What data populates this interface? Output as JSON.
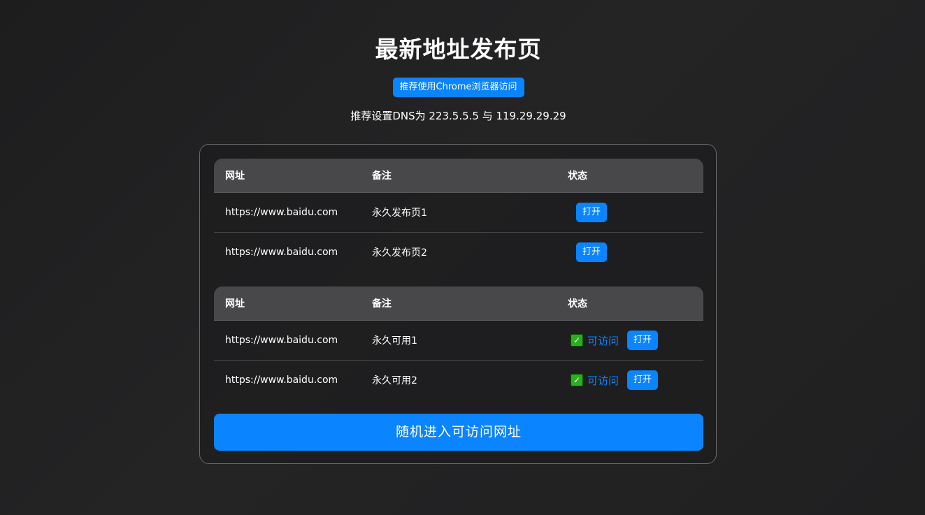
{
  "page": {
    "title": "最新地址发布页",
    "badge": "推荐使用Chrome浏览器访问",
    "dns_tip": "推荐设置DNS为 223.5.5.5 与 119.29.29.29"
  },
  "tables": [
    {
      "headers": {
        "url": "网址",
        "note": "备注",
        "status": "状态"
      },
      "rows": [
        {
          "url": "https://www.baidu.com",
          "note": "永久发布页1",
          "open": "打开"
        },
        {
          "url": "https://www.baidu.com",
          "note": "永久发布页2",
          "open": "打开"
        }
      ]
    },
    {
      "headers": {
        "url": "网址",
        "note": "备注",
        "status": "状态"
      },
      "rows": [
        {
          "url": "https://www.baidu.com",
          "note": "永久可用1",
          "check": "✓",
          "status": "可访问",
          "open": "打开"
        },
        {
          "url": "https://www.baidu.com",
          "note": "永久可用2",
          "check": "✓",
          "status": "可访问",
          "open": "打开"
        }
      ]
    }
  ],
  "random_button": "随机进入可访问网址",
  "colors": {
    "accent": "#0a84ff",
    "check": "#2ab01b",
    "table_header": "#48484a",
    "background": "#1f1f20"
  },
  "icons": {
    "check": "check-box-icon"
  }
}
